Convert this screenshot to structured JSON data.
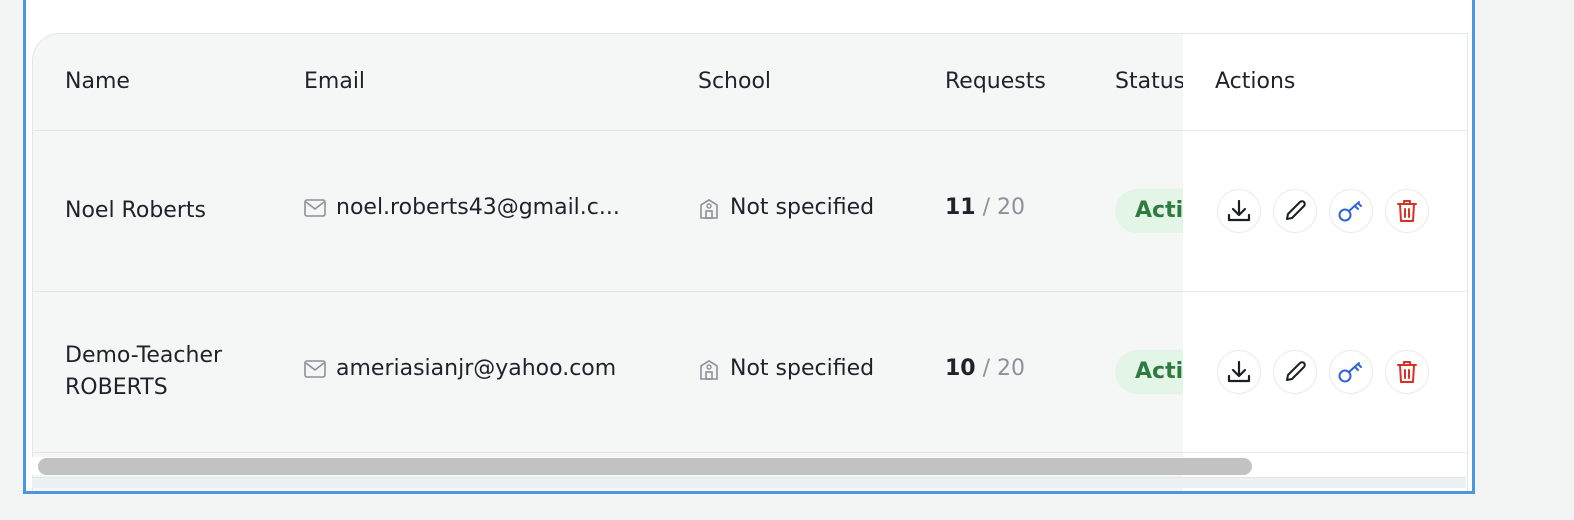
{
  "table": {
    "columns": {
      "name": "Name",
      "email": "Email",
      "school": "School",
      "requests": "Requests",
      "status": "Status",
      "actions": "Actions"
    },
    "rows": [
      {
        "name": "Noel Roberts",
        "email": "noel.roberts43@gmail.c...",
        "school": "Not specified",
        "requests_used": "11",
        "requests_sep": "/",
        "requests_limit": "20",
        "status": "Activ"
      },
      {
        "name": "Demo-Teacher ROBERTS",
        "email": "ameriasianjr@yahoo.com",
        "school": "Not specified",
        "requests_used": "10",
        "requests_sep": "/",
        "requests_limit": "20",
        "status": "Activ"
      }
    ]
  },
  "icons": {
    "email": "mail-icon",
    "school": "school-building-icon",
    "download": "download-icon",
    "edit": "pencil-icon",
    "key": "key-icon",
    "delete": "trash-icon"
  },
  "colors": {
    "frame_border": "#4a97e0",
    "status_bg": "#e3f5e7",
    "status_text": "#2f7a3e",
    "key_icon": "#2f63d6",
    "delete_icon": "#d93025"
  }
}
